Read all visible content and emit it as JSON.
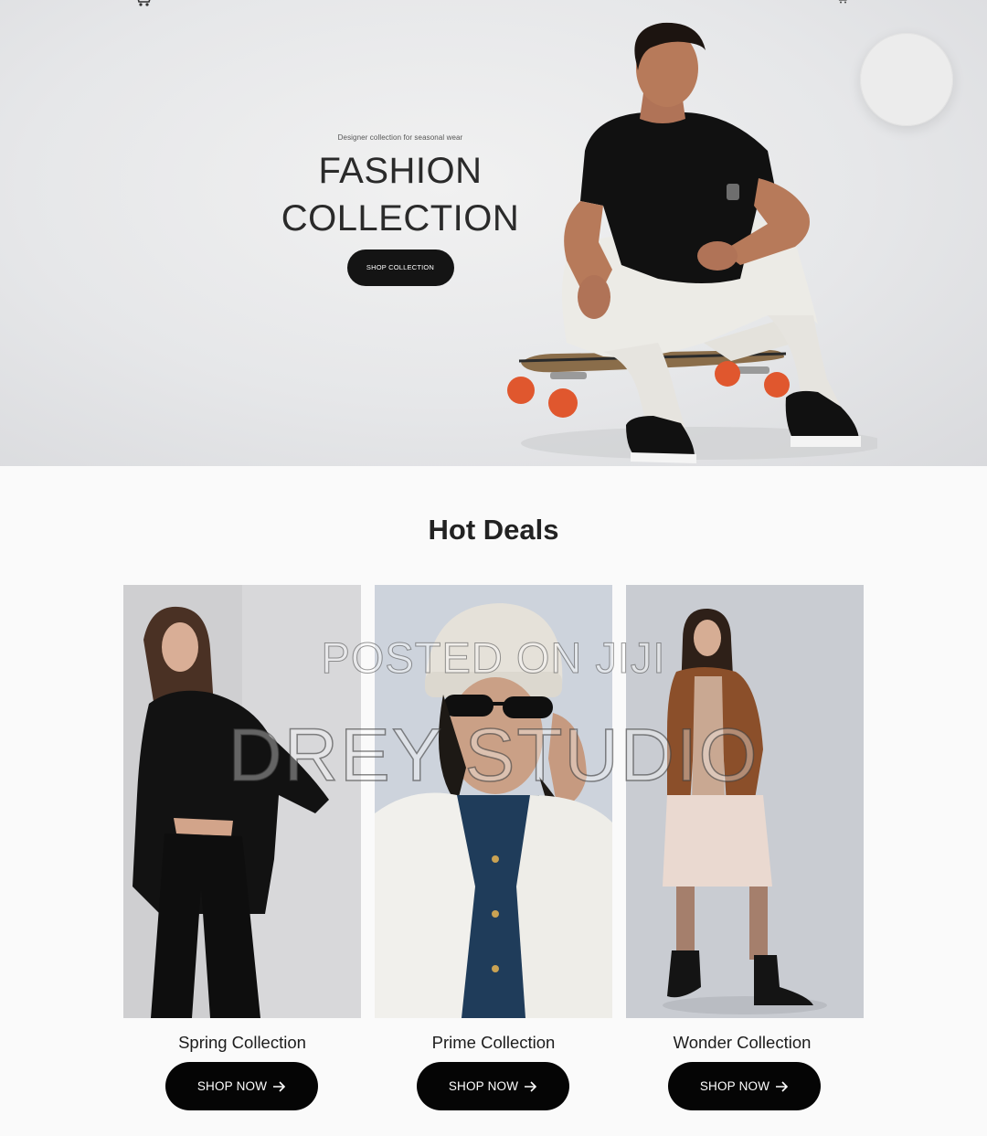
{
  "hero": {
    "tagline": "Designer collection for seasonal wear",
    "title_line1": "FASHION",
    "title_line2": "COLLECTION",
    "cta_label": "SHOP COLLECTION"
  },
  "deals": {
    "title": "Hot Deals",
    "cards": [
      {
        "label": "Spring Collection",
        "cta": "SHOP NOW"
      },
      {
        "label": "Prime Collection",
        "cta": "SHOP NOW"
      },
      {
        "label": "Wonder Collection",
        "cta": "SHOP NOW"
      }
    ]
  },
  "watermark": {
    "line1": "POSTED ON JIJI",
    "line2": "DREY STUDIO"
  },
  "icons": {
    "cart": "cart-icon",
    "arrow": "arrow-right-icon"
  },
  "colors": {
    "button": "#050505",
    "button_text": "#ffffff",
    "skateboard_wheels": "#e0572e"
  }
}
